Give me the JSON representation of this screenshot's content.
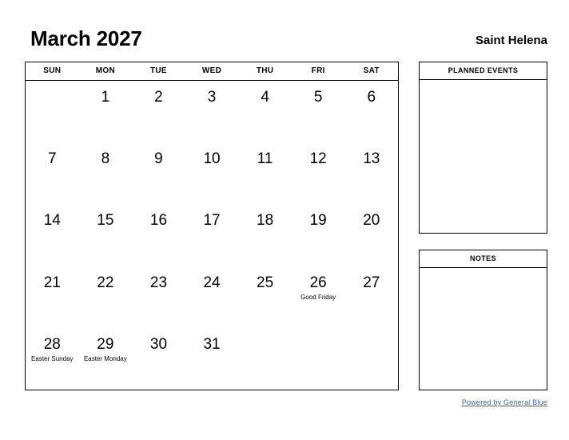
{
  "header": {
    "month_title": "March 2027",
    "location": "Saint Helena"
  },
  "calendar": {
    "weekdays": [
      "SUN",
      "MON",
      "TUE",
      "WED",
      "THU",
      "FRI",
      "SAT"
    ],
    "weeks": [
      [
        {
          "day": ""
        },
        {
          "day": "1"
        },
        {
          "day": "2"
        },
        {
          "day": "3"
        },
        {
          "day": "4"
        },
        {
          "day": "5"
        },
        {
          "day": "6"
        }
      ],
      [
        {
          "day": "7"
        },
        {
          "day": "8"
        },
        {
          "day": "9"
        },
        {
          "day": "10"
        },
        {
          "day": "11"
        },
        {
          "day": "12"
        },
        {
          "day": "13"
        }
      ],
      [
        {
          "day": "14"
        },
        {
          "day": "15"
        },
        {
          "day": "16"
        },
        {
          "day": "17"
        },
        {
          "day": "18"
        },
        {
          "day": "19"
        },
        {
          "day": "20"
        }
      ],
      [
        {
          "day": "21"
        },
        {
          "day": "22"
        },
        {
          "day": "23"
        },
        {
          "day": "24"
        },
        {
          "day": "25"
        },
        {
          "day": "26",
          "event": "Good Friday"
        },
        {
          "day": "27"
        }
      ],
      [
        {
          "day": "28",
          "event": "Easter Sunday"
        },
        {
          "day": "29",
          "event": "Easter Monday"
        },
        {
          "day": "30"
        },
        {
          "day": "31"
        },
        {
          "day": ""
        },
        {
          "day": ""
        },
        {
          "day": ""
        }
      ]
    ]
  },
  "panels": {
    "planned_events": {
      "title": "PLANNED EVENTS",
      "content": ""
    },
    "notes": {
      "title": "NOTES",
      "content": ""
    }
  },
  "footer": {
    "link_text": "Powered by General Blue",
    "link_color": "#3366cc"
  }
}
